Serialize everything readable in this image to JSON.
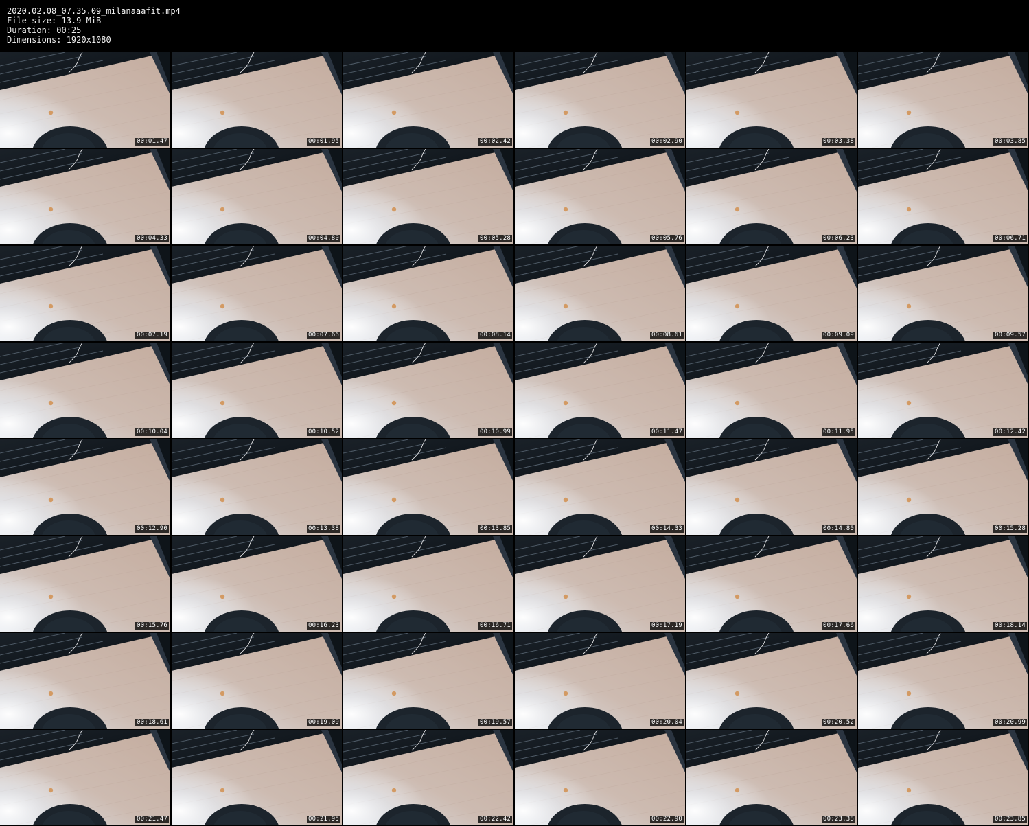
{
  "header": {
    "filename": "2020.02.08_07.35.09_milanaaafit.mp4",
    "file_size": "File size: 13.9 MiB",
    "duration": "Duration: 00:25",
    "dimensions": "Dimensions: 1920x1080"
  },
  "thumbnails": [
    "00:01.47",
    "00:01.95",
    "00:02.42",
    "00:02.90",
    "00:03.38",
    "00:03.85",
    "00:04.33",
    "00:04.80",
    "00:05.28",
    "00:05.76",
    "00:06.23",
    "00:06.71",
    "00:07.19",
    "00:07.66",
    "00:08.14",
    "00:08.61",
    "00:09.09",
    "00:09.57",
    "00:10.04",
    "00:10.52",
    "00:10.99",
    "00:11.47",
    "00:11.95",
    "00:12.42",
    "00:12.90",
    "00:13.38",
    "00:13.85",
    "00:14.33",
    "00:14.80",
    "00:15.28",
    "00:15.76",
    "00:16.23",
    "00:16.71",
    "00:17.19",
    "00:17.66",
    "00:18.14",
    "00:18.61",
    "00:19.09",
    "00:19.57",
    "00:20.04",
    "00:20.52",
    "00:20.99",
    "00:21.47",
    "00:21.95",
    "00:22.42",
    "00:22.90",
    "00:23.38",
    "00:23.85"
  ]
}
